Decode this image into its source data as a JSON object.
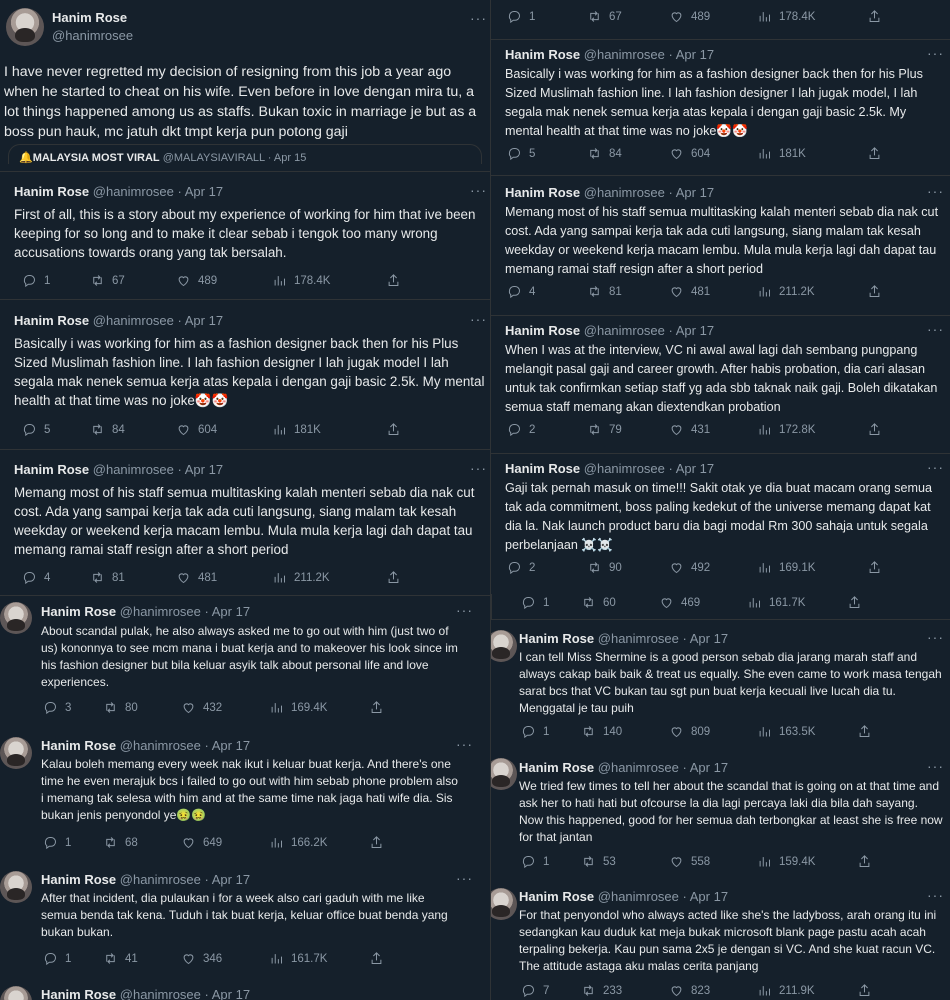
{
  "author": {
    "name": "Hanim Rose",
    "handle": "@hanimrosee",
    "date": "Apr 17",
    "dot": "·"
  },
  "more": "···",
  "left": {
    "main_tweet": {
      "text": "I have never regretted my decision of resigning from this job a year ago when he started to cheat on his wife. Even before in love dengan mira tu, a lot things happened among us as staffs. Bukan toxic in marriage je but as a boss pun hauk, mc jatuh dkt tmpt kerja pun potong gaji",
      "quote_name": "🔔MALAYSIA MOST VIRAL",
      "quote_handle": "@MALAYSIAVIRALL · Apr 15"
    },
    "tweets": [
      {
        "text": "First of all, this is a story about my experience of working for him that ive been keeping for so long and to make it clear sebab i tengok too many wrong accusations towards orang yang tak bersalah.",
        "replies": "1",
        "retweets": "67",
        "likes": "489",
        "views": "178.4K"
      },
      {
        "text": "Basically i was working for him as a fashion designer back then for his Plus Sized Muslimah fashion line. I lah fashion designer I lah jugak model I lah segala mak nenek semua kerja atas kepala i dengan gaji basic 2.5k. My mental health at that time was no joke🤡🤡",
        "replies": "5",
        "retweets": "84",
        "likes": "604",
        "views": "181K"
      },
      {
        "text": "Memang most of his staff semua multitasking kalah menteri sebab dia nak cut cost. Ada yang sampai kerja tak ada cuti langsung, siang malam tak kesah weekday or weekend kerja macam lembu. Mula mula kerja lagi dah dapat tau memang ramai staff resign after a short period",
        "replies": "4",
        "retweets": "81",
        "likes": "481",
        "views": "211.2K"
      },
      {
        "text": "About scandal pulak, he also always asked me to go out with him (just two of us) kononnya to see mcm mana i buat kerja and to makeover his look since im his fashion designer but bila keluar asyik talk about personal life and love experiences.",
        "replies": "3",
        "retweets": "80",
        "likes": "432",
        "views": "169.4K"
      },
      {
        "text": "Kalau boleh memang every week nak ikut i keluar buat kerja. And there's one time he even merajuk bcs i failed to go out with him sebab phone problem also i memang tak selesa with him and at the same time nak jaga hati wife dia. Sis bukan jenis penyondol ye🤢🤢",
        "replies": "1",
        "retweets": "68",
        "likes": "649",
        "views": "166.2K"
      },
      {
        "text": "After that incident, dia pulaukan i for a week also cari gaduh with me like semua benda tak kena. Tuduh i tak buat kerja, keluar office buat benda yang bukan bukan.",
        "replies": "1",
        "retweets": "41",
        "likes": "346",
        "views": "161.7K"
      }
    ]
  },
  "right": {
    "top_actions": {
      "replies": "1",
      "retweets": "67",
      "likes": "489",
      "views": "178.4K"
    },
    "tweets": [
      {
        "text": "Basically i was working for him as a fashion designer back then for his Plus Sized Muslimah fashion line. I lah fashion designer I lah jugak model, I lah segala mak nenek semua kerja atas kepala i dengan gaji basic 2.5k. My mental health at that time was no joke🤡🤡",
        "replies": "5",
        "retweets": "84",
        "likes": "604",
        "views": "181K"
      },
      {
        "text": "Memang most of his staff semua multitasking kalah menteri sebab dia nak cut cost. Ada yang sampai kerja tak ada cuti langsung, siang malam tak kesah weekday or weekend kerja macam lembu. Mula mula kerja lagi dah dapat tau memang ramai staff resign after a short period",
        "replies": "4",
        "retweets": "81",
        "likes": "481",
        "views": "211.2K"
      },
      {
        "text": "When I was at the interview, VC ni awal awal lagi dah sembang pungpang melangit pasal gaji and career growth. After habis probation, dia cari alasan untuk tak confirmkan setiap staff yg ada sbb taknak naik gaji. Boleh dikatakan semua staff memang akan diextendkan probation",
        "replies": "2",
        "retweets": "79",
        "likes": "431",
        "views": "172.8K"
      },
      {
        "text": "Gaji tak pernah masuk on time!!! Sakit otak ye dia buat macam orang semua tak ada commitment, boss paling kedekut of the universe memang dapat kat dia la. Nak launch product baru dia bagi modal Rm 300 sahaja untuk segala perbelanjaan ☠️☠️",
        "replies": "2",
        "retweets": "90",
        "likes": "492",
        "views": "169.1K",
        "sub_replies": "1",
        "sub_retweets": "60",
        "sub_likes": "469",
        "sub_views": "161.7K"
      },
      {
        "text": "I can tell Miss Shermine is a good person sebab dia jarang marah staff and always cakap baik baik & treat us equally. She even came to work masa tengah sarat bcs that VC bukan tau sgt pun buat kerja kecuali live lucah dia tu. Menggatal je tau puih",
        "replies": "1",
        "retweets": "140",
        "likes": "809",
        "views": "163.5K"
      },
      {
        "text": "We tried few times to tell her about the scandal that is going on at that time and ask her to hati hati but ofcourse la dia lagi percaya laki dia bila dah sayang. Now this happened, good for her semua dah terbongkar at least she is free now for that jantan",
        "replies": "1",
        "retweets": "53",
        "likes": "558",
        "views": "159.4K"
      },
      {
        "text": "For that penyondol who always acted like she's the ladyboss, arah orang itu ini sedangkan kau duduk kat meja bukak microsoft blank page pastu acah acah terpaling bekerja. Kau pun sama 2x5 je dengan si VC. And she kuat racun VC. The attitude astaga aku malas cerita panjang",
        "replies": "7",
        "retweets": "233",
        "likes": "823",
        "views": "211.9K"
      }
    ]
  }
}
